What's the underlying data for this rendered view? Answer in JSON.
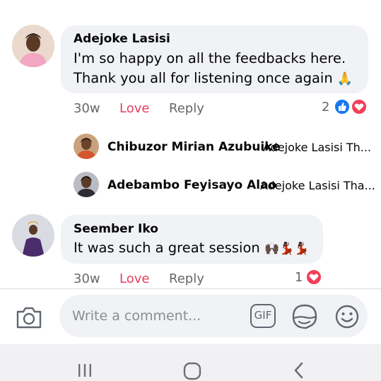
{
  "comments": [
    {
      "author": "Adejoke Lasisi",
      "line1": "I'm so happy on all the feedbacks here.",
      "line2": "Thank you all for listening once again",
      "emoji": "🙏",
      "time": "30w",
      "love_label": "Love",
      "reply_label": "Reply",
      "reaction_count": "2",
      "reactions": [
        "like-icon",
        "love-icon"
      ],
      "replies": [
        {
          "name": "Chibuzor Mirian Azubuike",
          "preview": "Adejoke Lasisi Th..."
        },
        {
          "name": "Adebambo Feyisayo Alao",
          "preview": "Adejoke Lasisi Tha..."
        }
      ]
    },
    {
      "author": "Seember Iko",
      "line1": "It was such a great session",
      "emojis": "🙌🏿💃🏿💃🏿",
      "time": "30w",
      "love_label": "Love",
      "reply_label": "Reply",
      "reaction_count": "1",
      "reactions": [
        "love-icon"
      ]
    }
  ],
  "composer": {
    "placeholder": "Write a comment...",
    "gif_label": "GIF"
  },
  "colors": {
    "bubble": "#f0f2f5",
    "love": "#e4405f",
    "like_blue": "#1877f2",
    "secondary_text": "#65676b"
  },
  "nav": [
    "recent-apps-icon",
    "home-icon",
    "back-icon"
  ]
}
